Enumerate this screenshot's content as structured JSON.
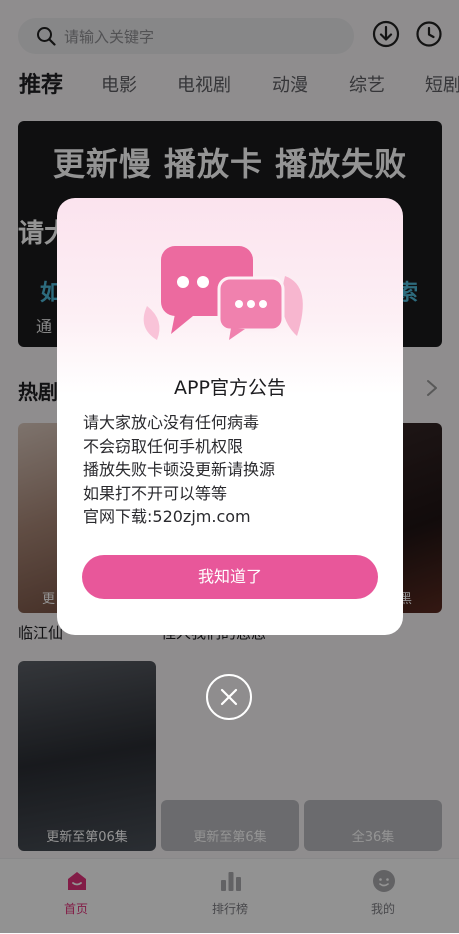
{
  "search": {
    "placeholder": "请输入关键字",
    "icon": "search-icon"
  },
  "header_icons": [
    "download-icon",
    "history-clock-icon"
  ],
  "tabs": [
    {
      "label": "推荐",
      "active": true
    },
    {
      "label": "电影"
    },
    {
      "label": "电视剧"
    },
    {
      "label": "动漫"
    },
    {
      "label": "综艺"
    },
    {
      "label": "短剧"
    }
  ],
  "banner": {
    "headline": "更新慢 播放卡 播放失败",
    "partial_left": "请大",
    "partial_blue_left": "如",
    "partial_blue_right": "索",
    "partial_small": "通"
  },
  "section": {
    "title": "热剧",
    "more_icon": "chevron-right-icon"
  },
  "cards_row1": [
    {
      "badge": "更",
      "title": "临江仙"
    },
    {
      "badge": "",
      "title": "怪人我们的恶恶"
    },
    {
      "badge": "黑",
      "title": ""
    }
  ],
  "cards_row2": [
    {
      "badge": "更新至第06集"
    },
    {
      "badge": "更新至第6集"
    },
    {
      "badge": "全36集"
    }
  ],
  "tabbar": [
    {
      "label": "首页",
      "icon": "home-icon",
      "active": true
    },
    {
      "label": "排行榜",
      "icon": "ranking-icon"
    },
    {
      "label": "我的",
      "icon": "profile-icon"
    }
  ],
  "dialog": {
    "title": "APP官方公告",
    "lines": [
      "请大家放心没有任何病毒",
      "不会窃取任何手机权限",
      "播放失败卡顿没更新请换源",
      "如果打不开可以等等",
      "官网下载:520zjm.com"
    ],
    "confirm": "我知道了",
    "illustration_icon": "chat-bubbles-icon",
    "close_icon": "close-icon"
  },
  "colors": {
    "accent": "#e8579a",
    "tab_active": "#e0327a"
  }
}
